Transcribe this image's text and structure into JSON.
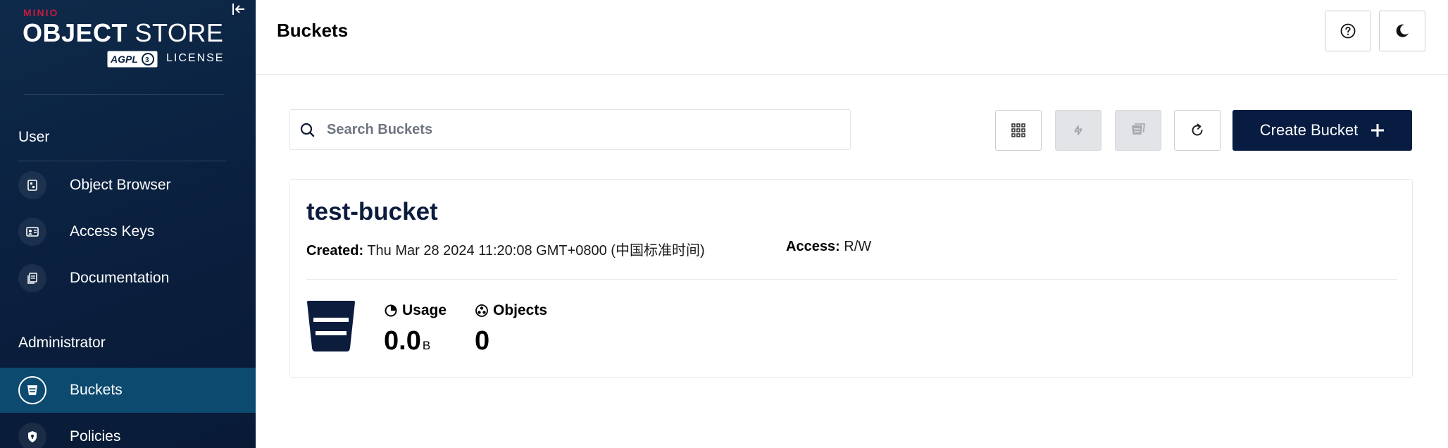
{
  "sidebar": {
    "logo": {
      "brand": "MINIO",
      "title_bold": "OBJECT",
      "title_light": "STORE",
      "license_badge": "AGPL v3",
      "license_label": "LICENSE"
    },
    "sections": [
      {
        "title": "User",
        "items": [
          {
            "label": "Object Browser",
            "icon": "object-browser-icon"
          },
          {
            "label": "Access Keys",
            "icon": "access-keys-icon"
          },
          {
            "label": "Documentation",
            "icon": "documentation-icon"
          }
        ]
      },
      {
        "title": "Administrator",
        "items": [
          {
            "label": "Buckets",
            "icon": "bucket-icon",
            "active": true
          },
          {
            "label": "Policies",
            "icon": "policy-icon"
          }
        ]
      }
    ]
  },
  "header": {
    "title": "Buckets",
    "help_icon": "help-icon",
    "theme_icon": "moon-icon"
  },
  "toolbar": {
    "search_placeholder": "Search Buckets",
    "search_value": "",
    "create_label": "Create Bucket"
  },
  "buckets": [
    {
      "name": "test-bucket",
      "created_label": "Created:",
      "created_value": "Thu Mar 28 2024 11:20:08 GMT+0800 (中国标准时间)",
      "access_label": "Access:",
      "access_value": "R/W",
      "usage_label": "Usage",
      "usage_value": "0.0",
      "usage_unit": "B",
      "objects_label": "Objects",
      "objects_value": "0"
    }
  ],
  "colors": {
    "sidebar_bg": "#0b2140",
    "sidebar_active": "#0d4a70",
    "accent_navy": "#081c42",
    "brand_red": "#c51b3f"
  }
}
